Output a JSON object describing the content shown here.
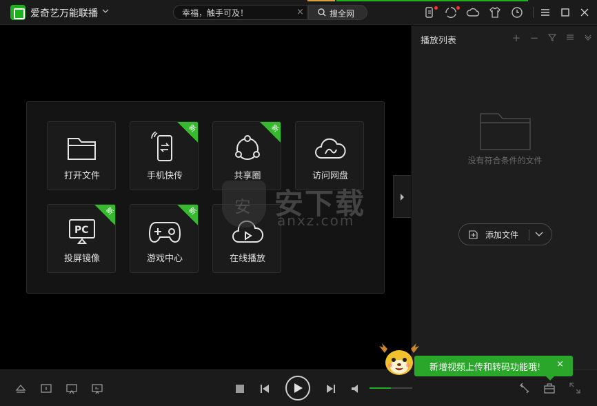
{
  "app": {
    "title": "爱奇艺万能联播",
    "brand_color": "#1fb01f"
  },
  "search": {
    "placeholder": "幸福，触手可及！",
    "button_label": "搜全网"
  },
  "titlebar_icons": [
    "phone-icon",
    "share-icon",
    "cloud-icon",
    "shirt-icon",
    "clock-icon"
  ],
  "window_controls": [
    "menu-icon",
    "minimize-icon",
    "maximize-icon",
    "close-icon"
  ],
  "launcher": {
    "tiles": [
      {
        "label": "打开文件",
        "icon": "folder-icon",
        "is_new": false,
        "new_label": ""
      },
      {
        "label": "手机快传",
        "icon": "phone-transfer-icon",
        "is_new": true,
        "new_label": "新"
      },
      {
        "label": "共享圈",
        "icon": "share-circle-icon",
        "is_new": true,
        "new_label": "新"
      },
      {
        "label": "访问网盘",
        "icon": "cloud-drive-icon",
        "is_new": false,
        "new_label": ""
      },
      {
        "label": "投屏镜像",
        "icon": "pc-mirror-icon",
        "is_new": true,
        "new_label": "新"
      },
      {
        "label": "游戏中心",
        "icon": "gamepad-icon",
        "is_new": true,
        "new_label": "新"
      },
      {
        "label": "在线播放",
        "icon": "cloud-play-icon",
        "is_new": false,
        "new_label": ""
      }
    ],
    "badge_color": "#37b92f"
  },
  "watermark": {
    "text": "安下载",
    "shield_text": "安",
    "url": "anxz.com"
  },
  "playlist": {
    "title": "播放列表",
    "empty_text": "没有符合条件的文件",
    "add_button_label": "添加文件"
  },
  "player": {
    "volume_percent": 50
  },
  "notification": {
    "text": "新增视频上传和转码功能哦!",
    "close": "×"
  }
}
